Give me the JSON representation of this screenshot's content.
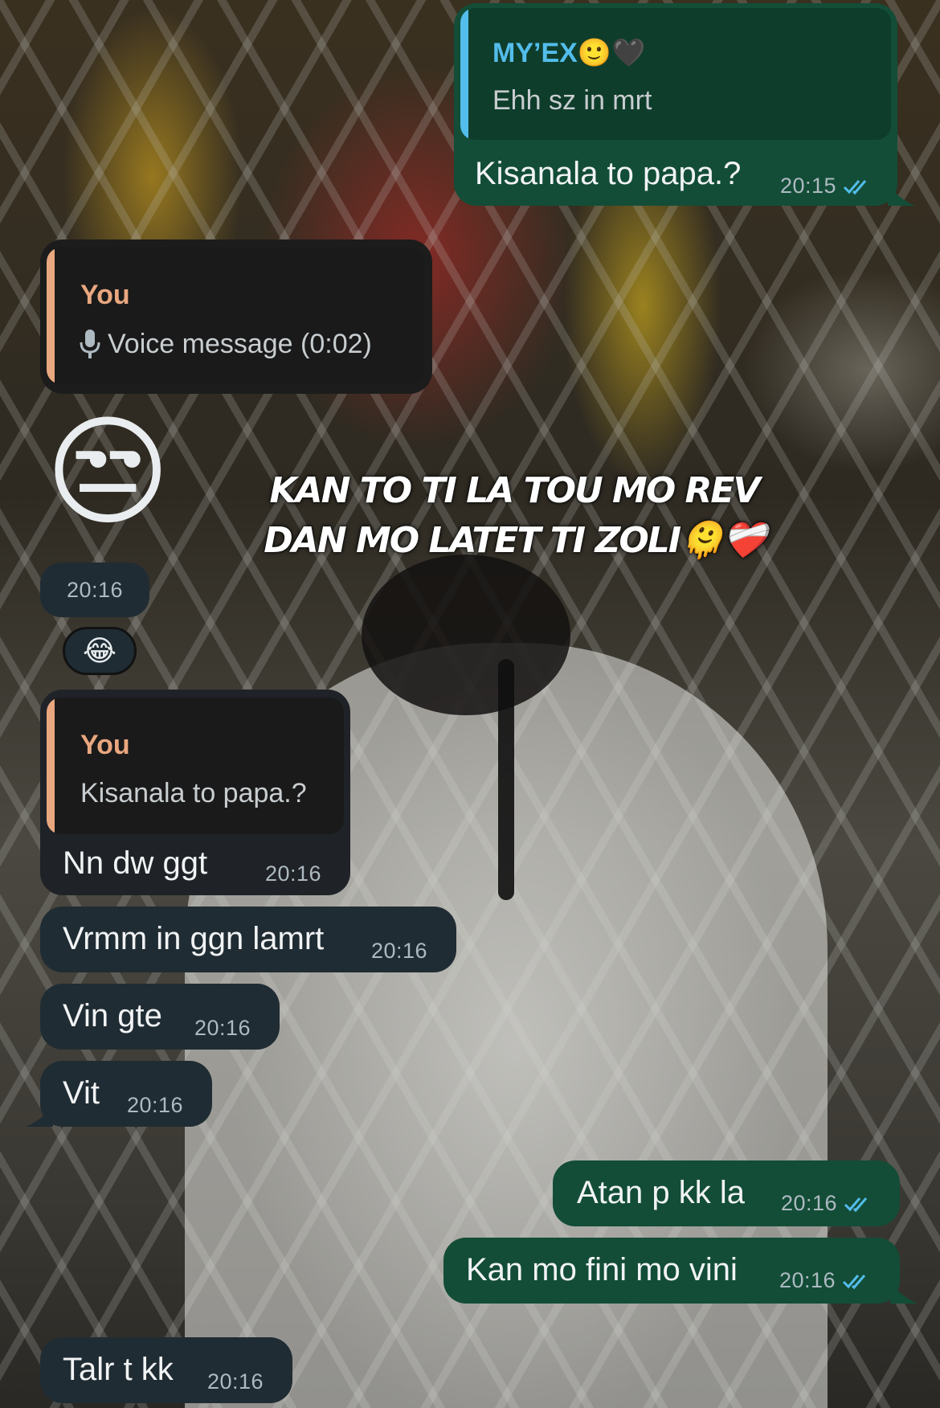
{
  "messages": [
    {
      "direction": "outgoing",
      "reply_to": {
        "name": "MY’EX",
        "name_emoji": "🙂🖤",
        "text": "Ehh sz in mrt"
      },
      "text": "Kisanala to papa.?",
      "time": "20:15",
      "status": "read"
    },
    {
      "direction": "incoming",
      "reply_to": {
        "name": "You",
        "text": "Voice message (0:02)",
        "icon": "microphone-icon"
      },
      "text": "",
      "time": ""
    },
    {
      "direction": "incoming",
      "sticker": "😒",
      "time": "20:16",
      "reaction": "😂"
    },
    {
      "direction": "incoming",
      "reply_to": {
        "name": "You",
        "text": "Kisanala to papa.?"
      },
      "text": "Nn dw ggt",
      "time": "20:16"
    },
    {
      "direction": "incoming",
      "text": "Vrmm in ggn lamrt",
      "time": "20:16"
    },
    {
      "direction": "incoming",
      "text": "Vin gte",
      "time": "20:16"
    },
    {
      "direction": "incoming",
      "text": "Vit",
      "time": "20:16"
    },
    {
      "direction": "outgoing",
      "text": "Atan p kk la",
      "time": "20:16",
      "status": "read"
    },
    {
      "direction": "outgoing",
      "text": "Kan mo fini mo vini",
      "time": "20:16",
      "status": "read"
    },
    {
      "direction": "incoming",
      "text": "Talr t kk",
      "time": "20:16"
    }
  ],
  "overlay": {
    "line1": "KAN TO TI LA TOU MO REV",
    "line2": "DAN MO LATET TI ZOLI🫠❤️‍🩹"
  },
  "colors": {
    "incoming_bubble": "#202c33",
    "outgoing_bubble": "#134d37",
    "quote_outgoing_accent": "#53bdeb",
    "quote_incoming_accent": "#e9a77f",
    "read_ticks": "#53bdeb"
  }
}
